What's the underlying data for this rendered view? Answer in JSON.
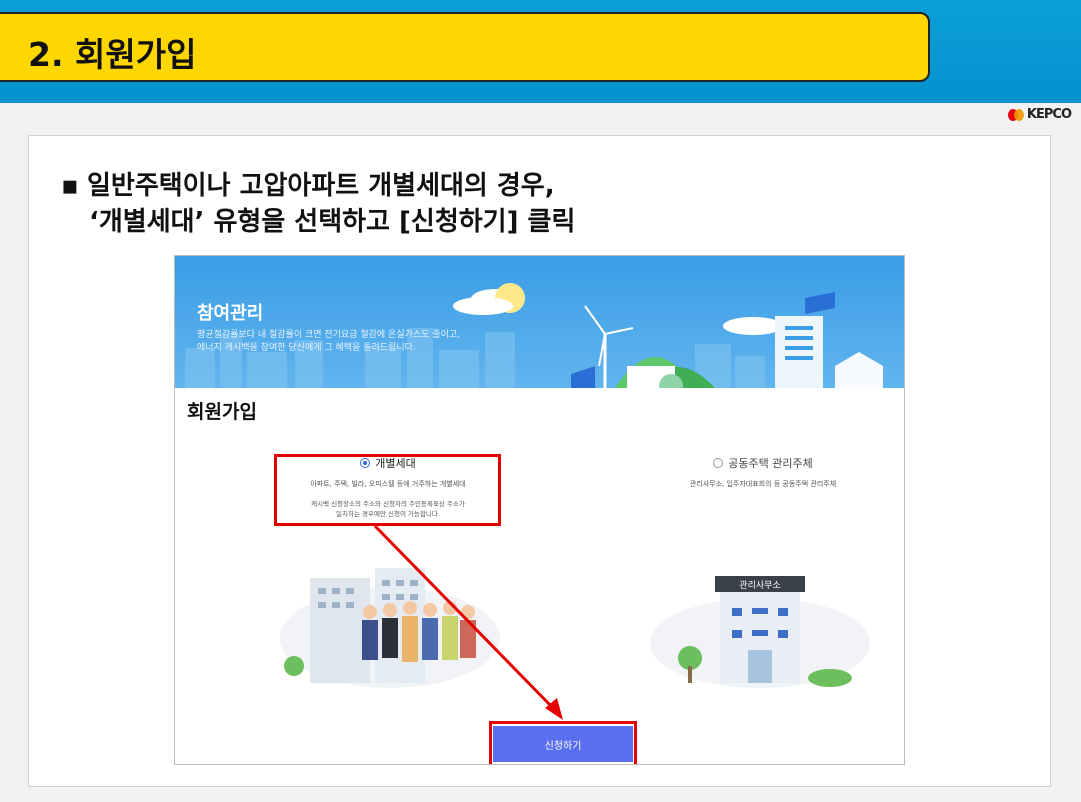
{
  "slide": {
    "title": "2. 회원가입",
    "logo_text": "KEPCO",
    "bullet_line1": "일반주택이나 고압아파트 개별세대의 경우,",
    "bullet_line2": "‘개별세대’ 유형을 선택하고 [신청하기] 클릭"
  },
  "banner": {
    "title": "참여관리",
    "desc_line1": "평균절감률보다 내 절감률이 크면 전기요금 절감에 온실가스도 줄이고,",
    "desc_line2": "에너지 캐시백을 참여한 당신에게 그 혜택을 돌려드립니다."
  },
  "form": {
    "title": "회원가입",
    "options": [
      {
        "label": "개별세대",
        "selected": true,
        "sub": "아파트, 주택, 빌라, 오피스텔 등에 거주하는 개별세대",
        "note_line1": "캐시백 신청장소의 주소와 신청자의 주민등록표상 주소가",
        "note_line2": "일치하는 경우에만 신청이 가능합니다."
      },
      {
        "label": "공동주택 관리주체",
        "selected": false,
        "sub": "관리사무소, 입주자대표회의 등 공동주택 관리주체"
      }
    ],
    "office_sign": "관리사무소",
    "submit_label": "신청하기"
  },
  "colors": {
    "header_blue": "#0592cf",
    "title_yellow": "#ffd700",
    "highlight_red": "#e60000",
    "button_blue": "#5a6ff0"
  }
}
